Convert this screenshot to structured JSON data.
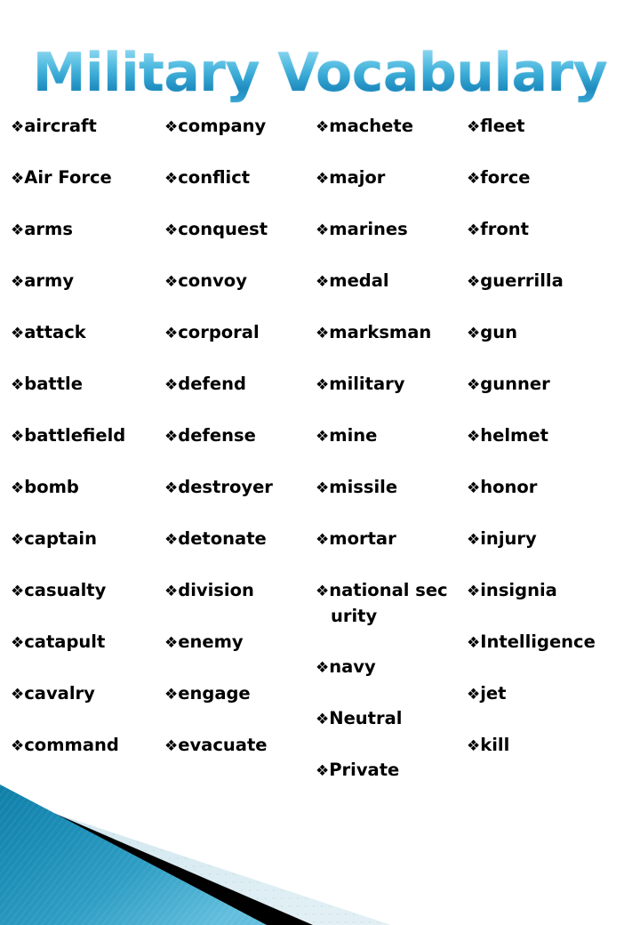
{
  "slide": {
    "title": "Military Vocabulary",
    "background_color": "#ffffff",
    "bullet_glyph": "❖",
    "bullet_icon_name": "diamond-bullet-icon"
  },
  "theme": {
    "title_gradient_top": "#bfeaf8",
    "title_gradient_mid": "#36a7d3",
    "title_gradient_bottom": "#1f8cc0",
    "decoration_teal": "#1a8cb5",
    "decoration_teal_light": "#54b4d6",
    "decoration_black": "#000000",
    "decoration_pale_blue": "#d6e9f0",
    "text_color": "#000000"
  },
  "columns": [
    {
      "id": "column-1",
      "words": [
        "aircraft",
        "Air Force",
        "arms",
        "army",
        "attack",
        "battle",
        "battlefield",
        "bomb",
        "captain",
        "casualty",
        "catapult",
        "cavalry",
        "command"
      ]
    },
    {
      "id": "column-2",
      "words": [
        "company",
        "conflict",
        "conquest",
        "convoy",
        "corporal",
        "defend",
        "defense",
        "destroyer",
        "detonate",
        "division",
        "enemy",
        "engage",
        "evacuate"
      ]
    },
    {
      "id": "column-3",
      "words": [
        "machete",
        "major",
        "marines",
        "medal",
        "marksman",
        "military",
        "mine",
        "missile",
        "mortar",
        "national security",
        "navy",
        "Neutral",
        "Private"
      ]
    },
    {
      "id": "column-4",
      "words": [
        "fleet",
        "force",
        "front",
        "guerrilla",
        "gun",
        "gunner",
        "helmet",
        "honor",
        "injury",
        "insignia",
        "Intelligence",
        "jet",
        "kill"
      ]
    }
  ]
}
